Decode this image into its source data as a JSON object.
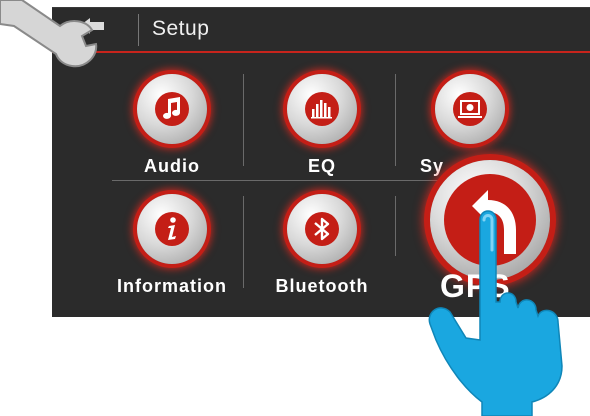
{
  "header": {
    "title": "Setup"
  },
  "menu": {
    "audio": "Audio",
    "eq": "EQ",
    "system": "Sy",
    "information": "Information",
    "bluetooth": "Bluetooth",
    "gps": "GPS"
  },
  "colors": {
    "accent": "#c41e16",
    "panel": "#2b2b2b",
    "hand": "#1aa7e0"
  }
}
